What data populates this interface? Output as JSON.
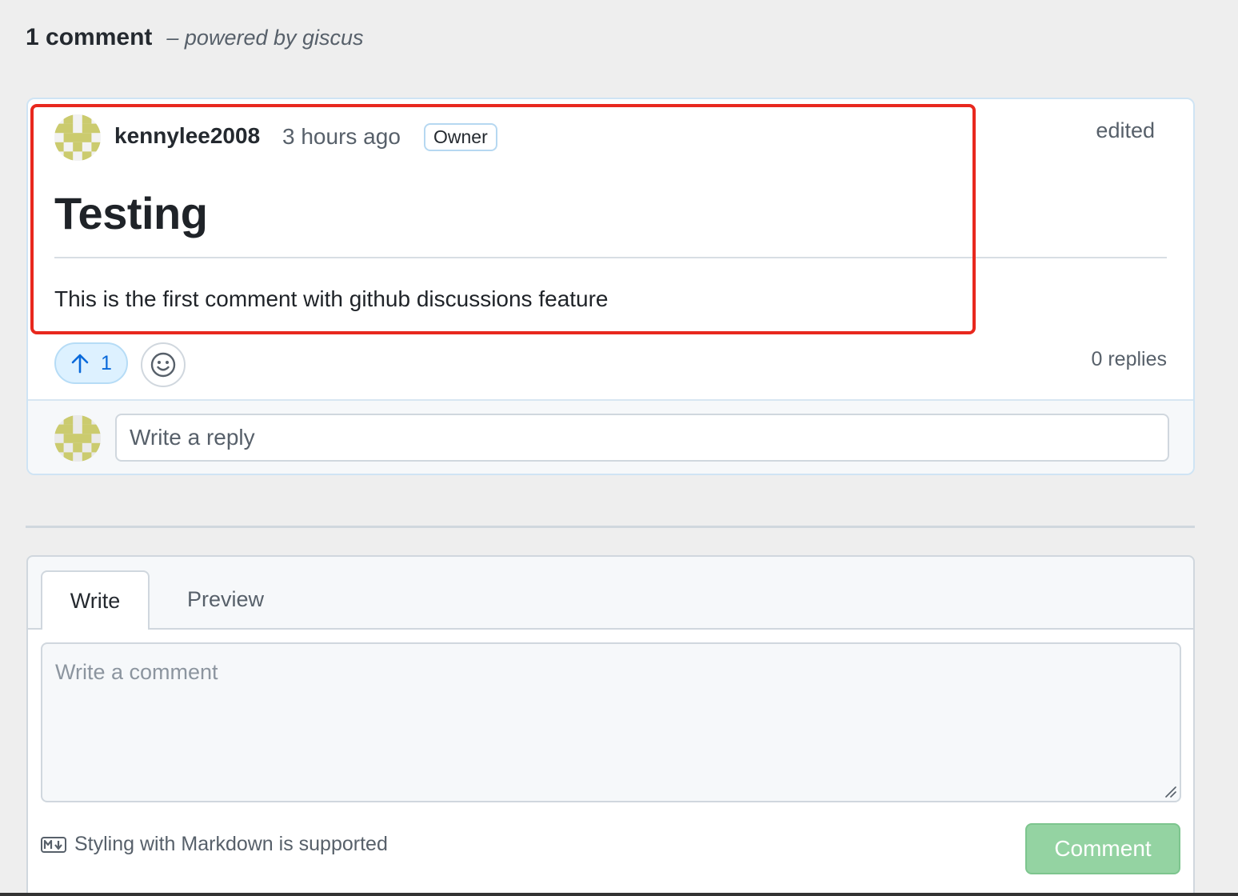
{
  "header": {
    "count_title": "1 comment",
    "powered_by": "– powered by giscus"
  },
  "comment": {
    "author": "kennylee2008",
    "timestamp": "3 hours ago",
    "badge": "Owner",
    "edited_label": "edited",
    "heading": "Testing",
    "body": "This is the first comment with github discussions feature",
    "upvote_count": "1",
    "replies": "0 replies",
    "reply_placeholder": "Write a reply"
  },
  "editor": {
    "tabs": [
      {
        "label": "Write",
        "active": true
      },
      {
        "label": "Preview",
        "active": false
      }
    ],
    "placeholder": "Write a comment",
    "markdown_note": "Styling with Markdown is supported",
    "submit_label": "Comment"
  },
  "colors": {
    "accent_blue": "#0969da",
    "submit_green": "#94d3a2",
    "highlight_red": "#e8281e",
    "avatar_pattern": "#cbcb6e"
  },
  "icons": [
    "arrow-up-icon",
    "smiley-icon",
    "markdown-icon",
    "resize-handle-icon"
  ]
}
